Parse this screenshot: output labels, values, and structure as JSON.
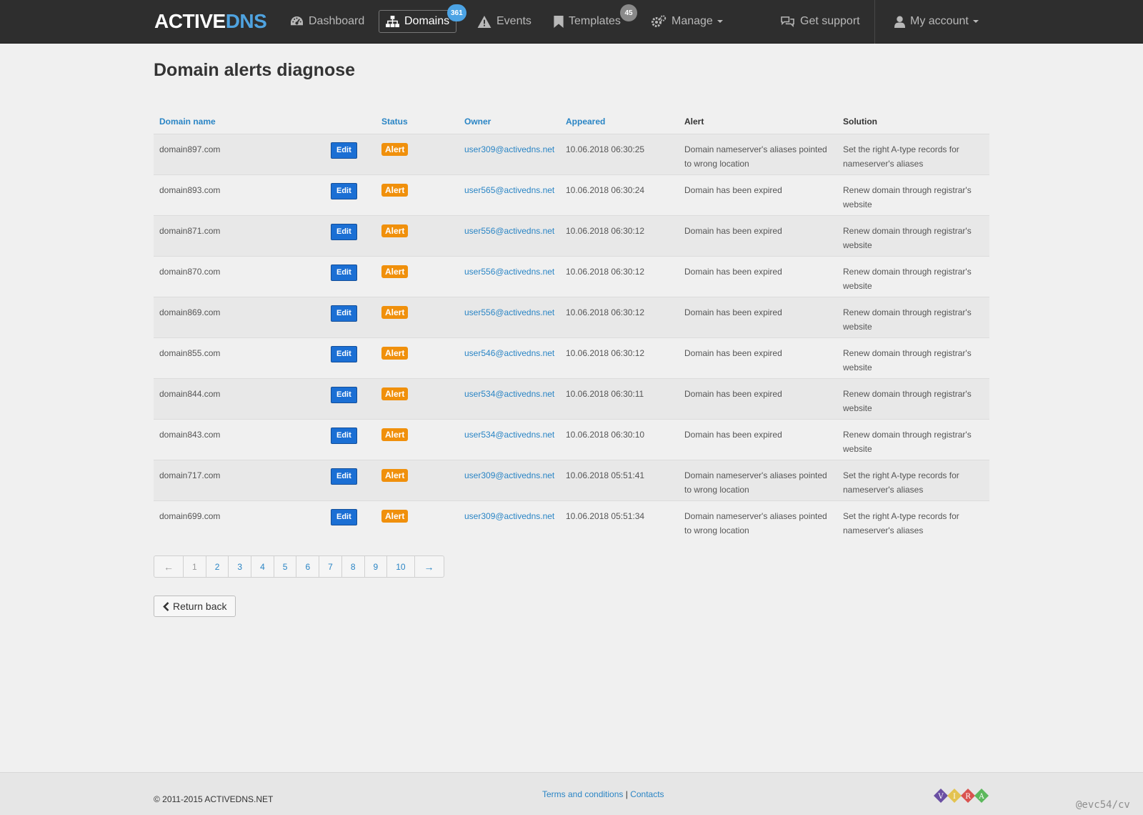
{
  "nav": {
    "brand_part1": "ACTIVE",
    "brand_part2": "DNS",
    "dashboard": "Dashboard",
    "domains": "Domains",
    "domains_badge": "361",
    "events": "Events",
    "templates": "Templates",
    "templates_badge": "45",
    "manage": "Manage",
    "get_support": "Get support",
    "my_account": "My account",
    "icons": {
      "dashboard": "speedometer-icon",
      "domains": "sitemap-icon",
      "events": "warning-triangle-icon",
      "templates": "bookmark-icon",
      "manage": "gears-icon",
      "get_support": "chat-bubbles-icon",
      "my_account": "user-icon"
    }
  },
  "page": {
    "title": "Domain alerts diagnose"
  },
  "table": {
    "headers": {
      "domain": "Domain name",
      "status": "Status",
      "owner": "Owner",
      "appeared": "Appeared",
      "alert": "Alert",
      "solution": "Solution"
    },
    "edit_label": "Edit",
    "rows": [
      {
        "domain": "domain897.com",
        "status": "Alert",
        "owner": "user309@activedns.net",
        "appeared": "10.06.2018 06:30:25",
        "alert": "Domain nameserver's aliases pointed to wrong location",
        "solution": "Set the right A-type records for nameserver's aliases"
      },
      {
        "domain": "domain893.com",
        "status": "Alert",
        "owner": "user565@activedns.net",
        "appeared": "10.06.2018 06:30:24",
        "alert": "Domain has been expired",
        "solution": "Renew domain through registrar's website"
      },
      {
        "domain": "domain871.com",
        "status": "Alert",
        "owner": "user556@activedns.net",
        "appeared": "10.06.2018 06:30:12",
        "alert": "Domain has been expired",
        "solution": "Renew domain through registrar's website"
      },
      {
        "domain": "domain870.com",
        "status": "Alert",
        "owner": "user556@activedns.net",
        "appeared": "10.06.2018 06:30:12",
        "alert": "Domain has been expired",
        "solution": "Renew domain through registrar's website"
      },
      {
        "domain": "domain869.com",
        "status": "Alert",
        "owner": "user556@activedns.net",
        "appeared": "10.06.2018 06:30:12",
        "alert": "Domain has been expired",
        "solution": "Renew domain through registrar's website"
      },
      {
        "domain": "domain855.com",
        "status": "Alert",
        "owner": "user546@activedns.net",
        "appeared": "10.06.2018 06:30:12",
        "alert": "Domain has been expired",
        "solution": "Renew domain through registrar's website"
      },
      {
        "domain": "domain844.com",
        "status": "Alert",
        "owner": "user534@activedns.net",
        "appeared": "10.06.2018 06:30:11",
        "alert": "Domain has been expired",
        "solution": "Renew domain through registrar's website"
      },
      {
        "domain": "domain843.com",
        "status": "Alert",
        "owner": "user534@activedns.net",
        "appeared": "10.06.2018 06:30:10",
        "alert": "Domain has been expired",
        "solution": "Renew domain through registrar's website"
      },
      {
        "domain": "domain717.com",
        "status": "Alert",
        "owner": "user309@activedns.net",
        "appeared": "10.06.2018 05:51:41",
        "alert": "Domain nameserver's aliases pointed to wrong location",
        "solution": "Set the right A-type records for nameserver's aliases"
      },
      {
        "domain": "domain699.com",
        "status": "Alert",
        "owner": "user309@activedns.net",
        "appeared": "10.06.2018 05:51:34",
        "alert": "Domain nameserver's aliases pointed to wrong location",
        "solution": "Set the right A-type records for nameserver's aliases"
      }
    ]
  },
  "pagination": {
    "prev": "←",
    "next": "→",
    "current": "1",
    "pages": [
      "1",
      "2",
      "3",
      "4",
      "5",
      "6",
      "7",
      "8",
      "9",
      "10"
    ]
  },
  "return_back": "Return back",
  "footer": {
    "copyright": "© 2011-2015 ACTIVEDNS.NET",
    "terms": "Terms and conditions",
    "separator": "|",
    "contacts": "Contacts",
    "vira_letters": [
      "V",
      "I",
      "R",
      "A"
    ],
    "vira_colors": [
      "#6a4fa3",
      "#e3c350",
      "#d9534f",
      "#5cb85c"
    ],
    "watermark": "@evc54/cv"
  },
  "colors": {
    "navbar": "#2e2e2e",
    "accent_blue": "#2a85c5",
    "brand_blue": "#4fa3e0",
    "alert_orange": "#f0900c",
    "edit_blue": "#1b6fd4"
  }
}
